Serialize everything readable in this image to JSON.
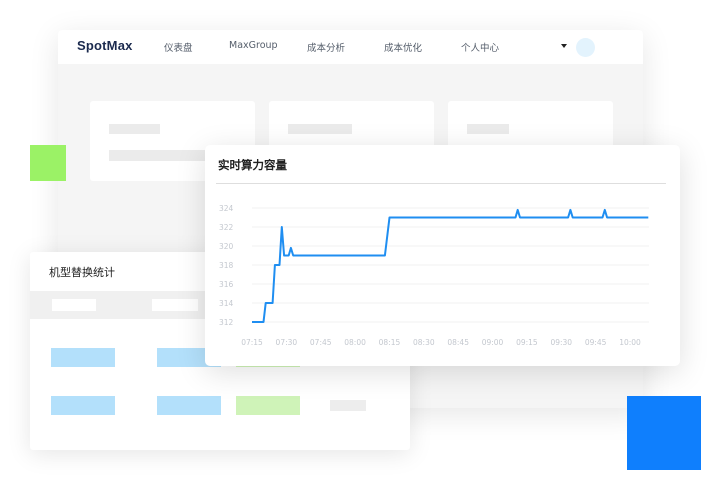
{
  "navbar": {
    "logo": "SpotMax",
    "items": [
      "仪表盘",
      "MaxGroup",
      "成本分析",
      "成本优化",
      "个人中心"
    ]
  },
  "model_card": {
    "title": "机型替换统计"
  },
  "chart_card": {
    "title": "实时算力容量"
  },
  "colors": {
    "accent_blue": "#0f7ffd",
    "accent_green": "#9bf266",
    "line": "#1f8ef1"
  },
  "chart_data": {
    "type": "line",
    "title": "实时算力容量",
    "xlabel": "",
    "ylabel": "",
    "x_ticks": [
      "07:15",
      "07:30",
      "07:45",
      "08:00",
      "08:15",
      "08:30",
      "08:45",
      "09:00",
      "09:15",
      "09:30",
      "09:45",
      "10:00"
    ],
    "y_ticks": [
      312,
      314,
      316,
      318,
      320,
      322,
      324
    ],
    "ylim": [
      312,
      324
    ],
    "grid": true,
    "series": [
      {
        "values": [
          [
            "07:15",
            312
          ],
          [
            "07:20",
            312
          ],
          [
            "07:21",
            314
          ],
          [
            "07:24",
            314
          ],
          [
            "07:25",
            318
          ],
          [
            "07:27",
            318
          ],
          [
            "07:28",
            322
          ],
          [
            "07:29",
            319
          ],
          [
            "07:31",
            319
          ],
          [
            "07:32",
            319.8
          ],
          [
            "07:33",
            319
          ],
          [
            "07:40",
            319
          ],
          [
            "08:00",
            319
          ],
          [
            "08:13",
            319
          ],
          [
            "08:15",
            323
          ],
          [
            "08:30",
            323
          ],
          [
            "08:45",
            323
          ],
          [
            "09:00",
            323
          ],
          [
            "09:10",
            323
          ],
          [
            "09:11",
            323.8
          ],
          [
            "09:12",
            323
          ],
          [
            "09:30",
            323
          ],
          [
            "09:33",
            323
          ],
          [
            "09:34",
            323.8
          ],
          [
            "09:35",
            323
          ],
          [
            "09:48",
            323
          ],
          [
            "09:49",
            323.8
          ],
          [
            "09:50",
            323
          ],
          [
            "10:00",
            323
          ],
          [
            "10:08",
            323
          ]
        ]
      }
    ]
  }
}
